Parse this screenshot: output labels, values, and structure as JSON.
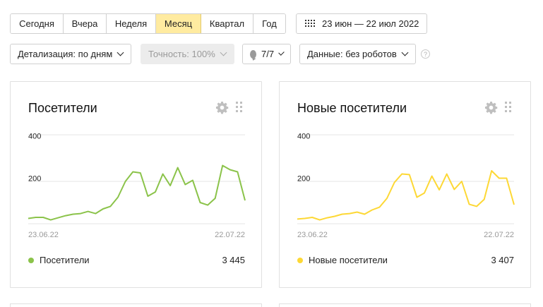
{
  "periods": [
    "Сегодня",
    "Вчера",
    "Неделя",
    "Месяц",
    "Квартал",
    "Год"
  ],
  "active_period": "Месяц",
  "date_range": "23 июн — 22 июл 2022",
  "controls": {
    "detail": "Детализация: по дням",
    "accuracy": "Точность: 100%",
    "segments": "7/7",
    "data_filter": "Данные: без роботов",
    "help": "?"
  },
  "colors": {
    "visitors": "#8bc34a",
    "new_visitors": "#fdd835",
    "active_bg": "#ffeba0"
  },
  "cards": [
    {
      "title": "Посетители",
      "legend": "Посетители",
      "total": "3 445",
      "gear": "gear-icon",
      "drag": "drag-handle-icon"
    },
    {
      "title": "Новые посетители",
      "legend": "Новые посетители",
      "total": "3 407",
      "gear": "gear-icon",
      "drag": "drag-handle-icon"
    }
  ],
  "chart_data": [
    {
      "type": "line",
      "x": [
        "23.06.22",
        "24.06.22",
        "25.06.22",
        "26.06.22",
        "27.06.22",
        "28.06.22",
        "29.06.22",
        "30.06.22",
        "01.07.22",
        "02.07.22",
        "03.07.22",
        "04.07.22",
        "05.07.22",
        "06.07.22",
        "07.07.22",
        "08.07.22",
        "09.07.22",
        "10.07.22",
        "11.07.22",
        "12.07.22",
        "13.07.22",
        "14.07.22",
        "15.07.22",
        "16.07.22",
        "17.07.22",
        "18.07.22",
        "19.07.22",
        "20.07.22",
        "21.07.22",
        "22.07.22"
      ],
      "series": [
        {
          "name": "Посетители",
          "values": [
            25,
            30,
            30,
            18,
            28,
            38,
            45,
            48,
            58,
            48,
            70,
            82,
            125,
            200,
            245,
            240,
            130,
            150,
            235,
            180,
            265,
            185,
            205,
            100,
            88,
            120,
            275,
            255,
            245,
            110
          ]
        }
      ],
      "xticks": [
        "23.06.22",
        "22.07.22"
      ],
      "yticks": [
        200,
        400
      ],
      "ylim": [
        0,
        420
      ],
      "grid": true
    },
    {
      "type": "line",
      "x": [
        "23.06.22",
        "24.06.22",
        "25.06.22",
        "26.06.22",
        "27.06.22",
        "28.06.22",
        "29.06.22",
        "30.06.22",
        "01.07.22",
        "02.07.22",
        "03.07.22",
        "04.07.22",
        "05.07.22",
        "06.07.22",
        "07.07.22",
        "08.07.22",
        "09.07.22",
        "10.07.22",
        "11.07.22",
        "12.07.22",
        "13.07.22",
        "14.07.22",
        "15.07.22",
        "16.07.22",
        "17.07.22",
        "18.07.22",
        "19.07.22",
        "20.07.22",
        "21.07.22",
        "22.07.22"
      ],
      "series": [
        {
          "name": "Новые посетители",
          "values": [
            22,
            25,
            30,
            18,
            28,
            35,
            45,
            48,
            55,
            45,
            65,
            78,
            120,
            195,
            235,
            232,
            125,
            145,
            225,
            160,
            235,
            162,
            200,
            92,
            82,
            115,
            250,
            215,
            215,
            90
          ]
        }
      ],
      "xticks": [
        "23.06.22",
        "22.07.22"
      ],
      "yticks": [
        200,
        400
      ],
      "ylim": [
        0,
        420
      ],
      "grid": true
    }
  ]
}
